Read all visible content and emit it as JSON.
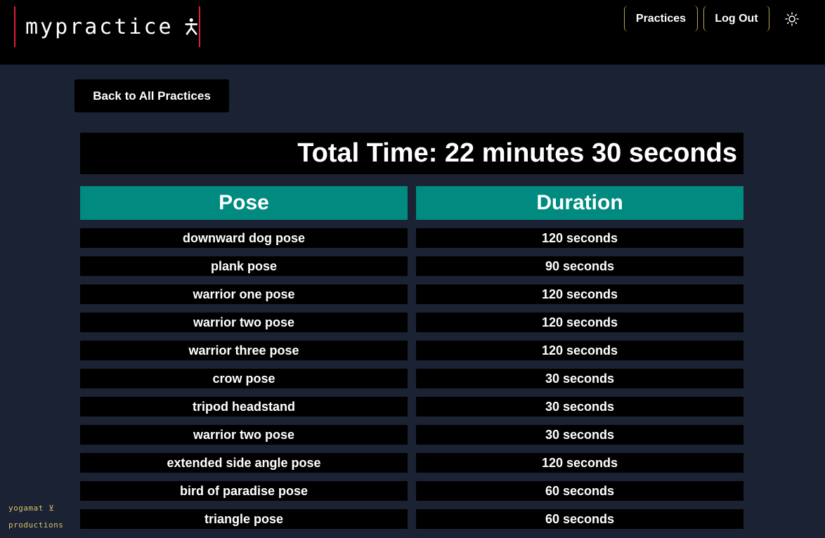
{
  "header": {
    "logo_text": "mypractice",
    "logo_icon": "stick-figure-icon",
    "nav": {
      "practices_label": "Practices",
      "logout_label": "Log Out"
    },
    "theme_icon": "sun-icon"
  },
  "back_button_label": "Back to All Practices",
  "total_time": "Total Time: 22 minutes 30 seconds",
  "table": {
    "columns": [
      "Pose",
      "Duration"
    ],
    "rows": [
      {
        "pose": "downward dog pose",
        "duration": "120 seconds"
      },
      {
        "pose": "plank pose",
        "duration": "90 seconds"
      },
      {
        "pose": "warrior one pose",
        "duration": "120 seconds"
      },
      {
        "pose": "warrior two pose",
        "duration": "120 seconds"
      },
      {
        "pose": "warrior three pose",
        "duration": "120 seconds"
      },
      {
        "pose": "crow pose",
        "duration": "30 seconds"
      },
      {
        "pose": "tripod headstand",
        "duration": "30 seconds"
      },
      {
        "pose": "warrior two pose",
        "duration": "30 seconds"
      },
      {
        "pose": "extended side angle pose",
        "duration": "120 seconds"
      },
      {
        "pose": "bird of paradise pose",
        "duration": "60 seconds"
      },
      {
        "pose": "triangle pose",
        "duration": "60 seconds"
      }
    ]
  },
  "footer": {
    "credit_line1": "yogamat ⊻",
    "credit_line2": "productions"
  },
  "colors": {
    "page_background": "#1b2234",
    "header_cell": "#008a80",
    "logo_border": "#e0203a",
    "nav_border": "#b8a84a",
    "credit_text": "#d4c26a"
  }
}
